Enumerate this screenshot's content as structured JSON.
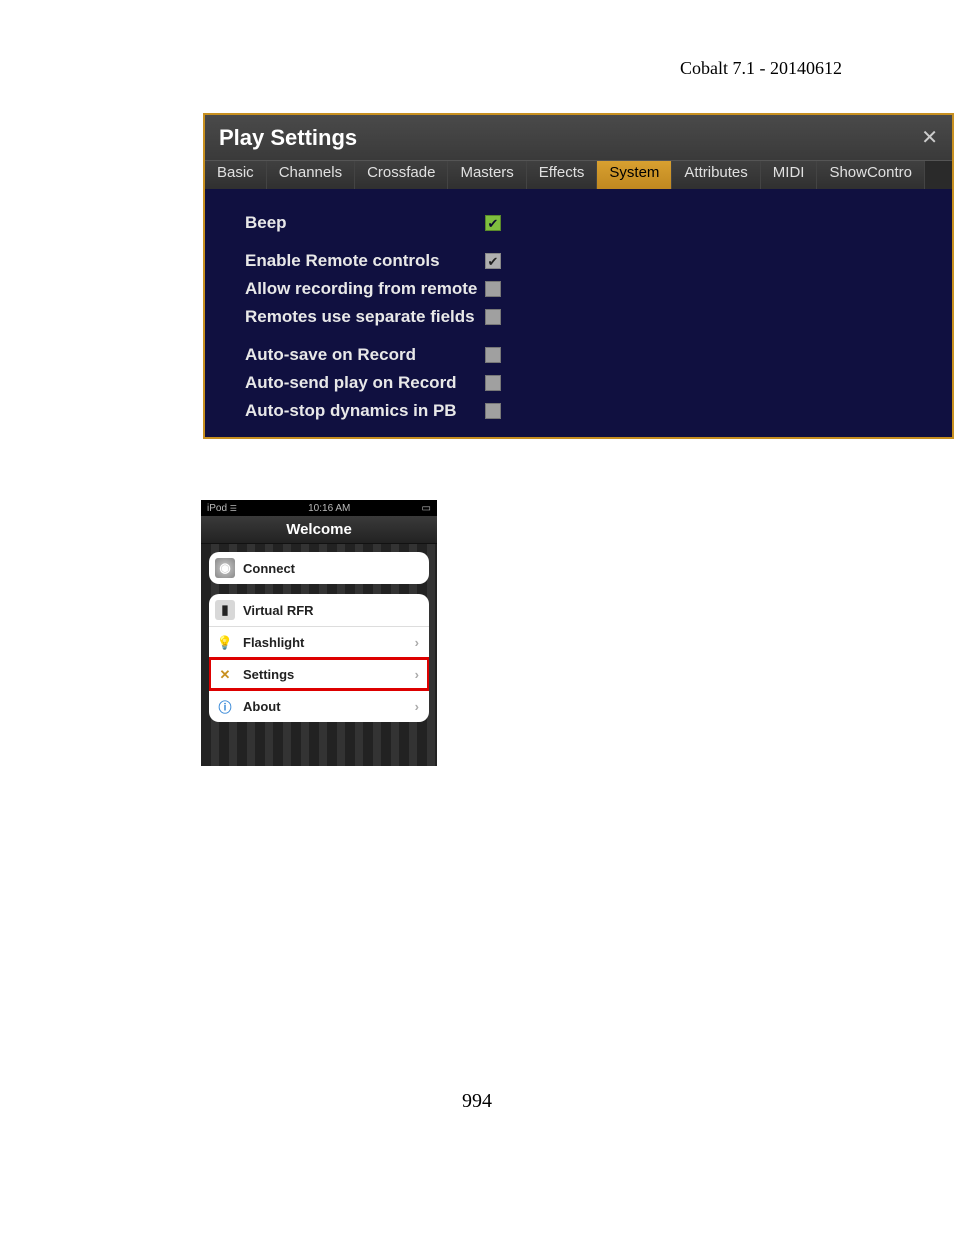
{
  "header": {
    "text": "Cobalt 7.1 - 20140612"
  },
  "page_number": "994",
  "play_settings": {
    "title": "Play Settings",
    "tabs": [
      {
        "label": "Basic",
        "active": false
      },
      {
        "label": "Channels",
        "active": false
      },
      {
        "label": "Crossfade",
        "active": false
      },
      {
        "label": "Masters",
        "active": false
      },
      {
        "label": "Effects",
        "active": false
      },
      {
        "label": "System",
        "active": true
      },
      {
        "label": "Attributes",
        "active": false
      },
      {
        "label": "MIDI",
        "active": false
      },
      {
        "label": "ShowContro",
        "active": false
      }
    ],
    "rows": [
      {
        "label": "Beep",
        "state": "green-checked"
      },
      {
        "gap": true
      },
      {
        "label": "Enable Remote controls",
        "state": "gray-checked"
      },
      {
        "label": "Allow recording from remote",
        "state": "gray-unchecked"
      },
      {
        "label": "Remotes use separate fields",
        "state": "gray-unchecked"
      },
      {
        "gap": true
      },
      {
        "label": "Auto-save on Record",
        "state": "gray-unchecked"
      },
      {
        "label": "Auto-send play on Record",
        "state": "gray-unchecked"
      },
      {
        "label": "Auto-stop dynamics in PB",
        "state": "gray-unchecked"
      }
    ]
  },
  "ipod": {
    "status": {
      "device": "iPod",
      "time": "10:16 AM"
    },
    "nav_title": "Welcome",
    "groups": [
      [
        {
          "label": "Connect",
          "icon": "globe",
          "chevron": false,
          "highlight": false
        }
      ],
      [
        {
          "label": "Virtual RFR",
          "icon": "rfr",
          "chevron": false,
          "highlight": false
        },
        {
          "label": "Flashlight",
          "icon": "bulb",
          "chevron": true,
          "highlight": false
        },
        {
          "label": "Settings",
          "icon": "tools",
          "chevron": true,
          "highlight": true
        },
        {
          "label": "About",
          "icon": "info",
          "chevron": true,
          "highlight": false
        }
      ]
    ]
  }
}
